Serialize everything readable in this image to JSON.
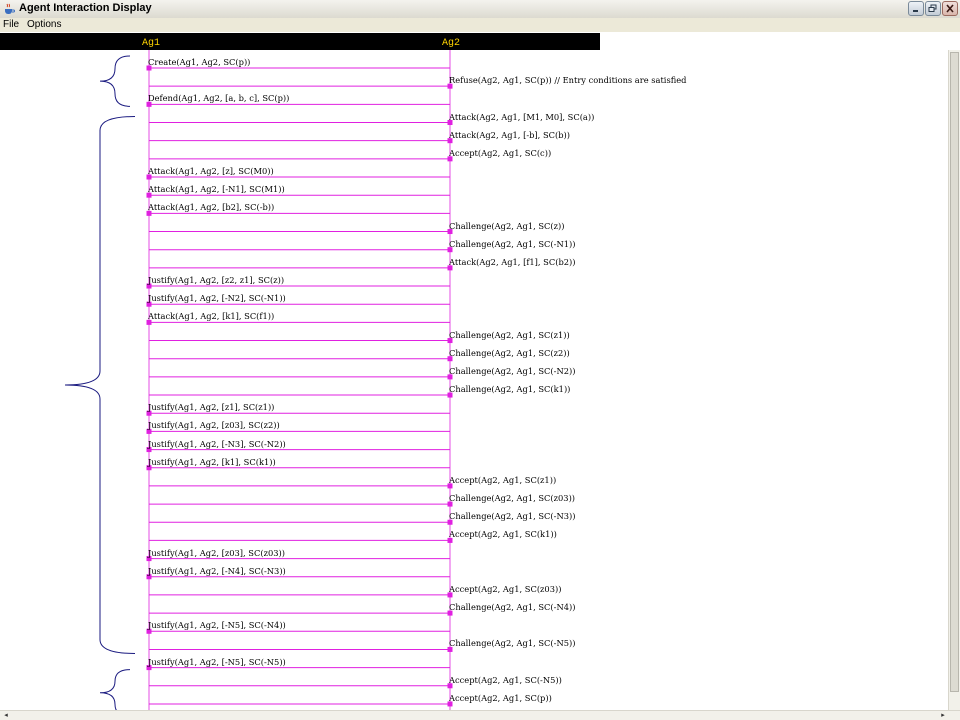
{
  "window": {
    "title": "Agent Interaction Display",
    "icon": "java-cup-icon"
  },
  "menu": {
    "items": [
      "File",
      "Options"
    ]
  },
  "agents": [
    "Ag1",
    "Ag2"
  ],
  "colors": {
    "lifeline": "#e020e0",
    "agent_label": "#ffd400",
    "brace": "#1a1a80",
    "header_bg": "#000000"
  },
  "messages": [
    {
      "from": "Ag1",
      "text": "Create(Ag1, Ag2, SC(p))"
    },
    {
      "from": "Ag2",
      "text": "Refuse(Ag2, Ag1, SC(p)) // Entry conditions are satisfied"
    },
    {
      "from": "Ag1",
      "text": "Defend(Ag1, Ag2, [a, b, c], SC(p))"
    },
    {
      "from": "Ag2",
      "text": "Attack(Ag2, Ag1, [M1, M0], SC(a))"
    },
    {
      "from": "Ag2",
      "text": "Attack(Ag2, Ag1, [-b], SC(b))"
    },
    {
      "from": "Ag2",
      "text": "Accept(Ag2, Ag1, SC(c))"
    },
    {
      "from": "Ag1",
      "text": "Attack(Ag1, Ag2, [z], SC(M0))"
    },
    {
      "from": "Ag1",
      "text": "Attack(Ag1, Ag2, [-N1], SC(M1))"
    },
    {
      "from": "Ag1",
      "text": "Attack(Ag1, Ag2, [b2], SC(-b))"
    },
    {
      "from": "Ag2",
      "text": "Challenge(Ag2, Ag1, SC(z))"
    },
    {
      "from": "Ag2",
      "text": "Challenge(Ag2, Ag1, SC(-N1))"
    },
    {
      "from": "Ag2",
      "text": "Attack(Ag2, Ag1, [f1], SC(b2))"
    },
    {
      "from": "Ag1",
      "text": "Justify(Ag1, Ag2, [z2, z1], SC(z))"
    },
    {
      "from": "Ag1",
      "text": "Justify(Ag1, Ag2, [-N2], SC(-N1))"
    },
    {
      "from": "Ag1",
      "text": "Attack(Ag1, Ag2, [k1], SC(f1))"
    },
    {
      "from": "Ag2",
      "text": "Challenge(Ag2, Ag1, SC(z1))"
    },
    {
      "from": "Ag2",
      "text": "Challenge(Ag2, Ag1, SC(z2))"
    },
    {
      "from": "Ag2",
      "text": "Challenge(Ag2, Ag1, SC(-N2))"
    },
    {
      "from": "Ag2",
      "text": "Challenge(Ag2, Ag1, SC(k1))"
    },
    {
      "from": "Ag1",
      "text": "Justify(Ag1, Ag2, [z1], SC(z1))"
    },
    {
      "from": "Ag1",
      "text": "Justify(Ag1, Ag2, [z03], SC(z2))"
    },
    {
      "from": "Ag1",
      "text": "Justify(Ag1, Ag2, [-N3], SC(-N2))"
    },
    {
      "from": "Ag1",
      "text": "Justify(Ag1, Ag2, [k1], SC(k1))"
    },
    {
      "from": "Ag2",
      "text": "Accept(Ag2, Ag1, SC(z1))"
    },
    {
      "from": "Ag2",
      "text": "Challenge(Ag2, Ag1, SC(z03))"
    },
    {
      "from": "Ag2",
      "text": "Challenge(Ag2, Ag1, SC(-N3))"
    },
    {
      "from": "Ag2",
      "text": "Accept(Ag2, Ag1, SC(k1))"
    },
    {
      "from": "Ag1",
      "text": "Justify(Ag1, Ag2, [z03], SC(z03))"
    },
    {
      "from": "Ag1",
      "text": "Justify(Ag1, Ag2, [-N4], SC(-N3))"
    },
    {
      "from": "Ag2",
      "text": "Accept(Ag2, Ag1, SC(z03))"
    },
    {
      "from": "Ag2",
      "text": "Challenge(Ag2, Ag1, SC(-N4))"
    },
    {
      "from": "Ag1",
      "text": "Justify(Ag1, Ag2, [-N5], SC(-N4))"
    },
    {
      "from": "Ag2",
      "text": "Challenge(Ag2, Ag1, SC(-N5))"
    },
    {
      "from": "Ag1",
      "text": "Justify(Ag1, Ag2, [-N5], SC(-N5))"
    },
    {
      "from": "Ag2",
      "text": "Accept(Ag2, Ag1, SC(-N5))"
    },
    {
      "from": "Ag2",
      "text": "Accept(Ag2, Ag1, SC(p))"
    }
  ],
  "braces": [
    {
      "from_message": 0,
      "to_message": 2
    },
    {
      "from_message": 3,
      "to_message": 32
    },
    {
      "from_message": 33,
      "to_message": 35
    }
  ]
}
